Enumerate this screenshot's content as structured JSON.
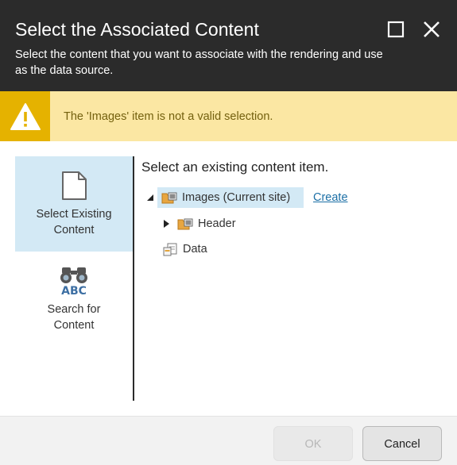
{
  "dialog": {
    "title": "Select the Associated Content",
    "subtitle": "Select the content that you want to associate with the rendering and use as the data source."
  },
  "header_buttons": {
    "maximize_icon": "maximize-icon",
    "close_icon": "close-icon"
  },
  "warning": {
    "message": "The 'Images' item is not a valid selection.",
    "icon": "warning-triangle-icon"
  },
  "nav": {
    "items": [
      {
        "label_line1": "Select Existing",
        "label_line2": "Content",
        "icon": "document-icon",
        "selected": true
      },
      {
        "label_line1": "Search for",
        "label_line2": "Content",
        "icon": "binoculars-abc-icon",
        "selected": false
      }
    ]
  },
  "main": {
    "heading": "Select an existing content item.",
    "create_link": "Create",
    "tree": [
      {
        "label": "Images (Current site)",
        "icon": "folder-images-icon",
        "expanded": true,
        "selected": true,
        "level": 0
      },
      {
        "label": "Header",
        "icon": "folder-images-icon",
        "expanded": false,
        "selected": false,
        "level": 1
      },
      {
        "label": "Data",
        "icon": "data-item-icon",
        "expanded": null,
        "selected": false,
        "level": 1
      }
    ]
  },
  "footer": {
    "ok_label": "OK",
    "cancel_label": "Cancel"
  },
  "colors": {
    "header_bg": "#2b2b2b",
    "warning_bg": "#fbe7a3",
    "warning_icon_bg": "#e5b200",
    "selection_bg": "#d3e9f5",
    "link": "#1b6fa6"
  }
}
